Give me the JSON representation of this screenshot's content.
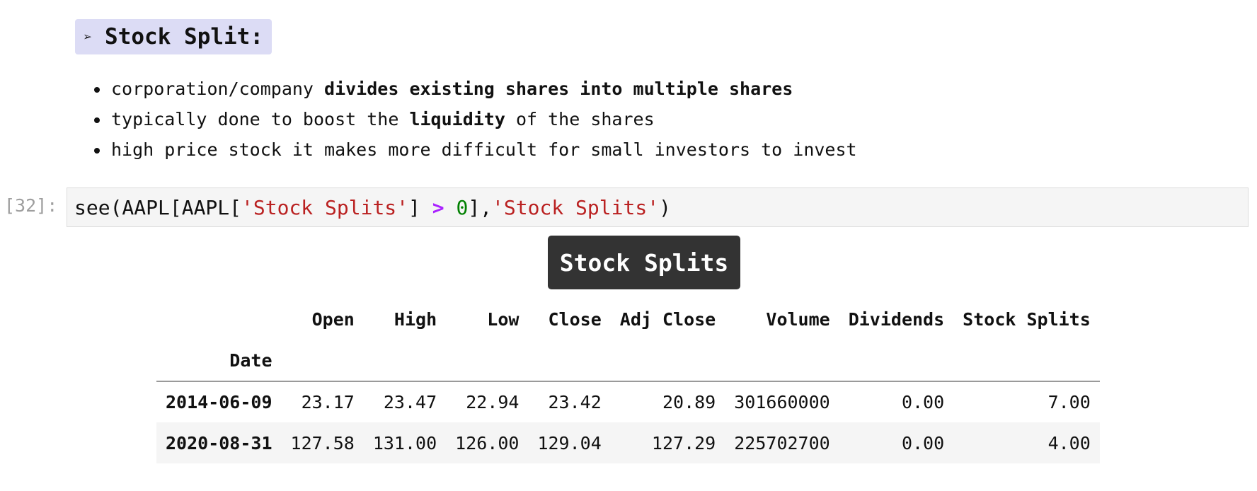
{
  "markdown": {
    "arrow": "➢",
    "heading": "Stock Split:",
    "bullets": [
      {
        "pre": "corporation/company ",
        "bold": "divides existing shares into multiple shares",
        "post": ""
      },
      {
        "pre": "typically done to boost the ",
        "bold": "liquidity",
        "post": " of the shares"
      },
      {
        "pre": "high price stock it makes more difficult for small investors to invest",
        "bold": "",
        "post": ""
      }
    ]
  },
  "code_cell": {
    "prompt": "[32]:",
    "tokens": {
      "t1": "see(AAPL[AAPL[",
      "t2": "'Stock Splits'",
      "t3": "] ",
      "t4": ">",
      "t5": " ",
      "t6": "0",
      "t7": "],",
      "t8": "'Stock Splits'",
      "t9": ")"
    }
  },
  "output": {
    "title": "Stock Splits",
    "index_name": "Date",
    "columns": [
      "Open",
      "High",
      "Low",
      "Close",
      "Adj Close",
      "Volume",
      "Dividends",
      "Stock Splits"
    ],
    "rows": [
      {
        "index": "2014-06-09",
        "cells": [
          "23.17",
          "23.47",
          "22.94",
          "23.42",
          "20.89",
          "301660000",
          "0.00",
          "7.00"
        ]
      },
      {
        "index": "2020-08-31",
        "cells": [
          "127.58",
          "131.00",
          "126.00",
          "129.04",
          "127.29",
          "225702700",
          "0.00",
          "4.00"
        ]
      }
    ]
  },
  "colors": {
    "heading_bg": "#dcdcf5",
    "string": "#ba2121",
    "operator": "#aa22ff",
    "number": "#008000",
    "title_pill_bg": "#333333"
  }
}
